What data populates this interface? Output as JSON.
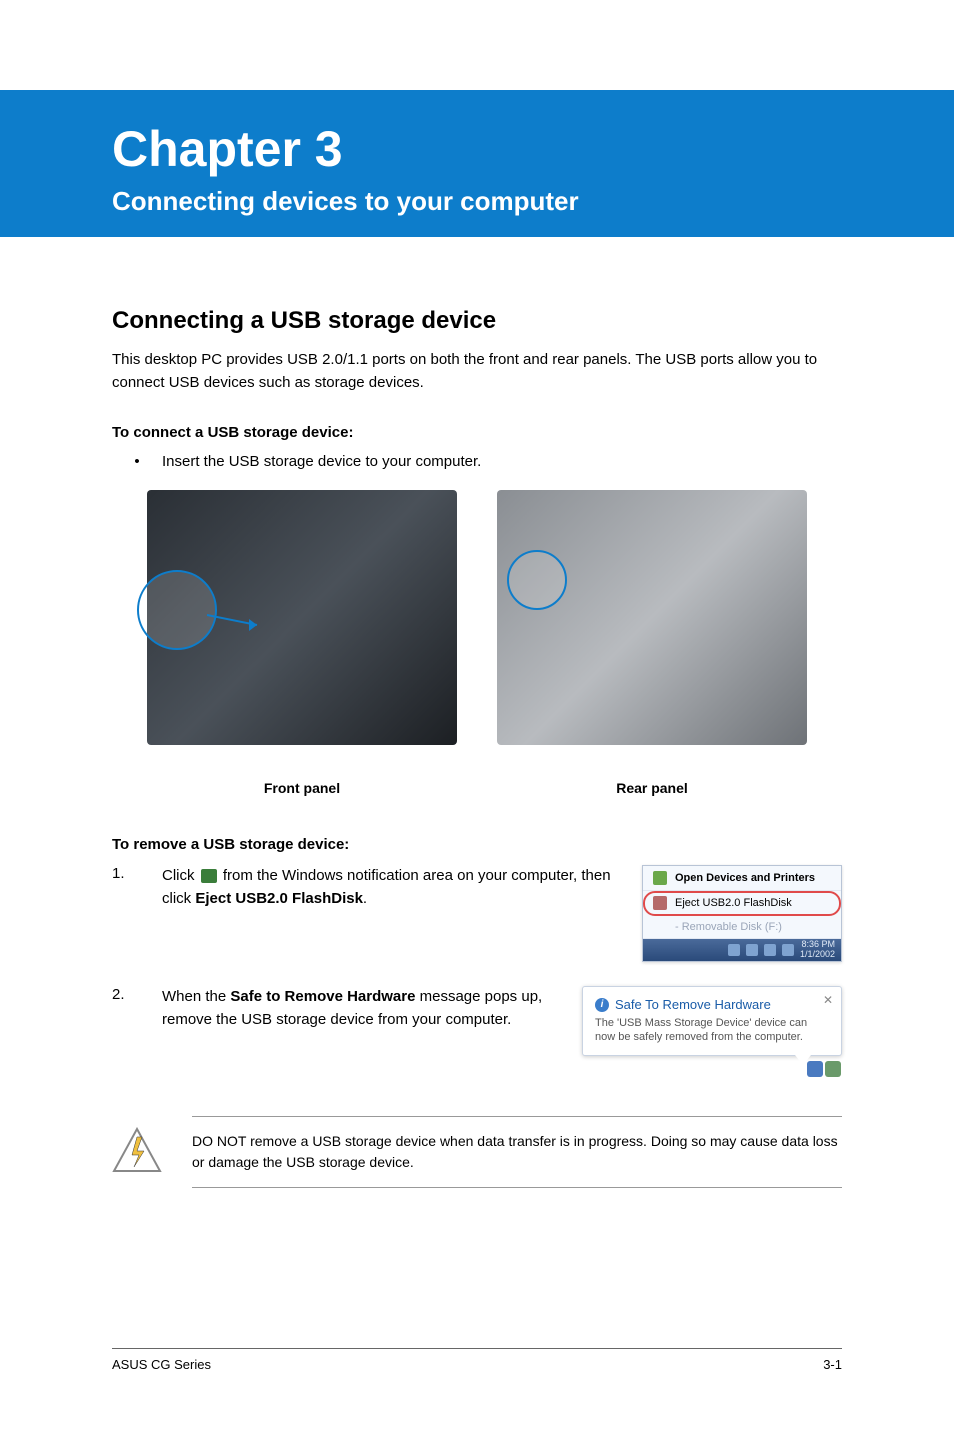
{
  "header": {
    "chapter": "Chapter 3",
    "subtitle": "Connecting devices to your computer"
  },
  "section": {
    "title": "Connecting a USB storage device",
    "intro": "This desktop PC provides USB 2.0/1.1 ports on both the front and rear panels. The USB ports allow you to connect USB devices such as storage devices.",
    "connect_heading": "To connect a USB storage device:",
    "connect_bullet": "Insert the USB storage device to your computer.",
    "front_label": "Front panel",
    "rear_label": "Rear panel",
    "remove_heading": "To remove a USB storage device:"
  },
  "steps": [
    {
      "num": "1.",
      "pre": "Click ",
      "post_icon": " from the Windows notification area on your computer, then click ",
      "bold": "Eject USB2.0 FlashDisk",
      "after": "."
    },
    {
      "num": "2.",
      "pre": "When the ",
      "bold": "Safe to Remove Hardware",
      "after": " message pops up, remove the USB storage device from your computer."
    }
  ],
  "tray": {
    "open": "Open Devices and Printers",
    "eject": "Eject USB2.0 FlashDisk",
    "removable": "- Removable Disk (F:)",
    "time_top": "8:36 PM",
    "date": "1/1/2002"
  },
  "balloon": {
    "title": "Safe To Remove Hardware",
    "body": "The 'USB Mass Storage Device' device can now be safely removed from the computer."
  },
  "warning": "DO NOT remove a USB storage device when data transfer is in progress. Doing so may cause data loss or damage the USB storage device.",
  "footer": {
    "left": "ASUS CG Series",
    "right": "3-1"
  }
}
